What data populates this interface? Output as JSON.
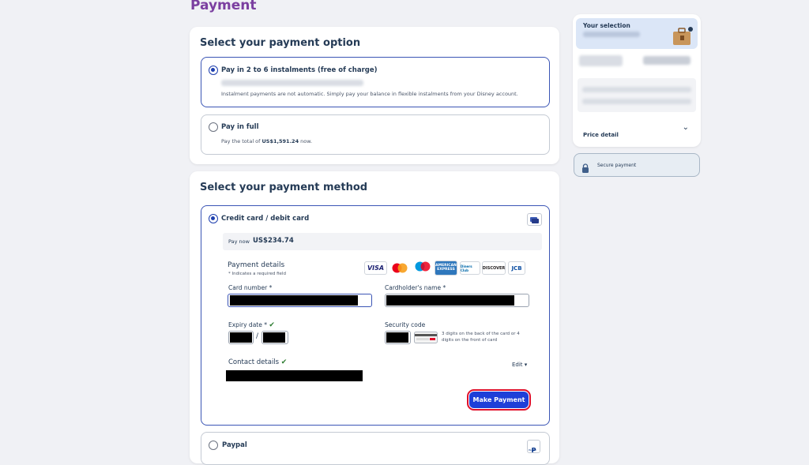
{
  "page": {
    "title": "Payment"
  },
  "option_section": {
    "title": "Select your payment option",
    "instalments": {
      "label": "Pay in 2 to 6 instalments (free of charge)",
      "note": "Instalment payments are not automatic. Simply pay your balance in flexible instalments from your Disney account."
    },
    "full": {
      "label": "Pay in full",
      "note_prefix": "Pay the total of",
      "amount": "US$1,591.24",
      "note_suffix": "now."
    }
  },
  "method_section": {
    "title": "Select your payment method",
    "credit": {
      "label": "Credit card / debit card",
      "pay_now_label": "Pay now",
      "pay_now_amount": "US$234.74",
      "details_title": "Payment details",
      "required_note": "* Indicates a required field",
      "card_logos": [
        "VISA",
        "MC",
        "MC",
        "AMERICAN EXPRESS",
        "Diners Club",
        "DISCOVER",
        "JCB"
      ],
      "card_number_label": "Card number",
      "holder_label": "Cardholder's name",
      "expiry_label": "Expiry date",
      "expiry_separator": "/",
      "security_label": "Security code",
      "security_hint": "3 digits on the back of the card or 4 digits on the front of card",
      "required_mark": "*",
      "contact_label": "Contact details",
      "edit_label": "Edit",
      "make_payment": "Make Payment"
    },
    "paypal": {
      "label": "Paypal",
      "logo": "PayPal"
    }
  },
  "summary": {
    "selection_title": "Your selection",
    "price_detail": "Price detail",
    "secure_payment": "Secure payment"
  },
  "colors": {
    "accent": "#1e3fd8",
    "title": "#7b3fa0",
    "highlight": "#e0102a"
  }
}
